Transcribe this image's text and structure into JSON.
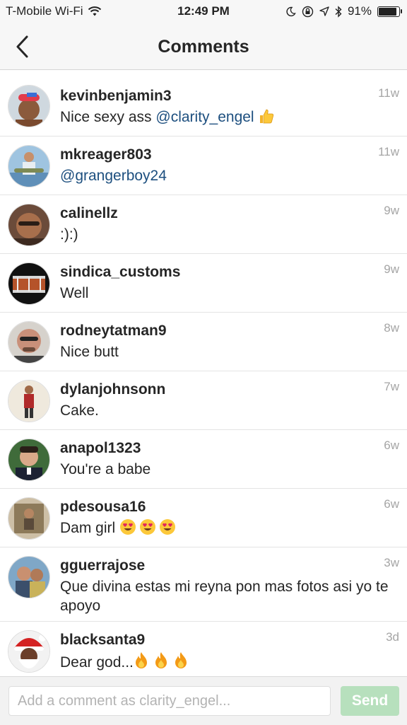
{
  "status_bar": {
    "carrier": "T-Mobile Wi-Fi",
    "time": "12:49 PM",
    "battery": "91%",
    "battery_level": 0.91
  },
  "header": {
    "title": "Comments",
    "back_icon": "chevron-left-icon"
  },
  "comments": [
    {
      "username": "kevinbenjamin3",
      "time": "11w",
      "parts": [
        "Nice sexy ass ",
        "@clarity_engel"
      ],
      "emoji": "thumbs-up-icon",
      "emoji_count": 1
    },
    {
      "username": "mkreager803",
      "time": "11w",
      "parts": [
        "",
        "@grangerboy24"
      ],
      "emoji": "",
      "emoji_count": 0
    },
    {
      "username": "calinellz",
      "time": "9w",
      "parts": [
        ":):)",
        ""
      ],
      "emoji": "",
      "emoji_count": 0
    },
    {
      "username": "sindica_customs",
      "time": "9w",
      "parts": [
        "Well",
        ""
      ],
      "emoji": "",
      "emoji_count": 0
    },
    {
      "username": "rodneytatman9",
      "time": "8w",
      "parts": [
        "Nice butt",
        ""
      ],
      "emoji": "",
      "emoji_count": 0
    },
    {
      "username": "dylanjohnsonn",
      "time": "7w",
      "parts": [
        "Cake.",
        ""
      ],
      "emoji": "",
      "emoji_count": 0
    },
    {
      "username": "anapol1323",
      "time": "6w",
      "parts": [
        "You're a babe",
        ""
      ],
      "emoji": "",
      "emoji_count": 0
    },
    {
      "username": "pdesousa16",
      "time": "6w",
      "parts": [
        "Dam girl ",
        ""
      ],
      "emoji": "heart-eyes-icon",
      "emoji_count": 3
    },
    {
      "username": "gguerrajose",
      "time": "3w",
      "parts": [
        "Que divina estas mi reyna pon mas fotos asi yo te apoyo",
        ""
      ],
      "emoji": "",
      "emoji_count": 0
    },
    {
      "username": "blacksanta9",
      "time": "3d",
      "parts": [
        "Dear god...",
        ""
      ],
      "emoji": "fire-icon",
      "emoji_count": 3
    }
  ],
  "composer": {
    "placeholder": "Add a comment as clarity_engel...",
    "send_label": "Send"
  },
  "colors": {
    "mention": "#1d4f7f",
    "send_disabled": "#b7e0bd",
    "timestamp": "#a5a5a5"
  }
}
